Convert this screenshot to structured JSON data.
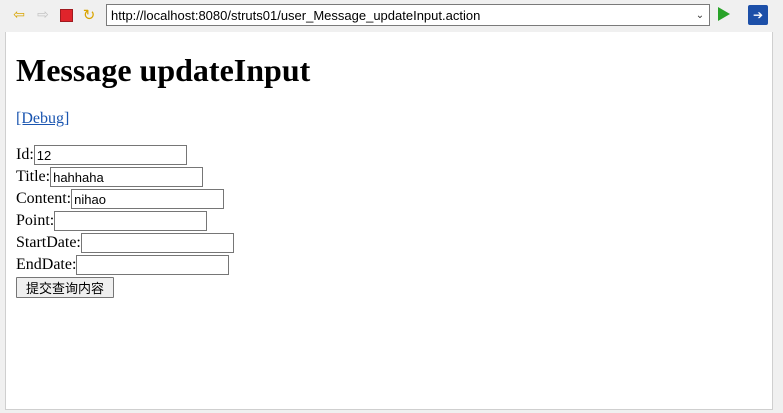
{
  "browser": {
    "url": "http://localhost:8080/struts01/user_Message_updateInput.action",
    "icons": {
      "back": "back-arrow-icon",
      "forward": "forward-arrow-icon",
      "stop": "stop-icon",
      "refresh": "refresh-icon",
      "go": "go-arrow-icon",
      "extension": "extension-icon",
      "dropdown": "chevron-down-icon"
    }
  },
  "page": {
    "title": "Message updateInput",
    "debug_link": "[Debug]",
    "form": {
      "fields": [
        {
          "label": "Id:",
          "value": ""
        },
        {
          "label": "Title:",
          "value": ""
        },
        {
          "label": "Content:",
          "value": ""
        },
        {
          "label": "Point:",
          "value": ""
        },
        {
          "label": "StartDate:",
          "value": ""
        },
        {
          "label": "EndDate:",
          "value": ""
        }
      ],
      "submit_label": "提交查询内容"
    }
  },
  "values": {
    "id": "12",
    "title": "hahhaha",
    "content": "nihao",
    "point": "",
    "start_date": "",
    "end_date": ""
  }
}
